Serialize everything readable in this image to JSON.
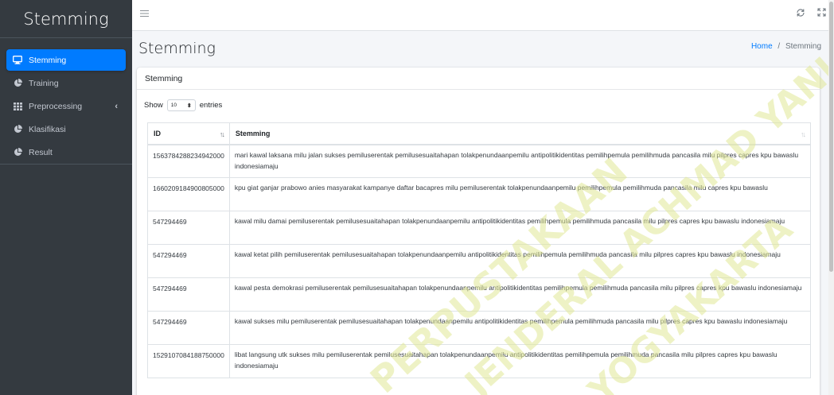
{
  "sidebar": {
    "brand": "Stemming",
    "items": [
      {
        "label": "Stemming",
        "icon": "desktop-icon",
        "active": true
      },
      {
        "label": "Training",
        "icon": "pie-chart-icon"
      },
      {
        "label": "Preprocessing",
        "icon": "table-icon"
      },
      {
        "label": "Klasifikasi",
        "icon": "pie-chart-icon"
      },
      {
        "label": "Result",
        "icon": "pie-chart-icon"
      }
    ]
  },
  "header": {
    "title": "Stemming",
    "breadcrumb_home": "Home",
    "breadcrumb_sep": "/",
    "breadcrumb_current": "Stemming"
  },
  "card": {
    "title": "Stemming",
    "show_label": "Show",
    "entries_value": "10",
    "entries_label": "entries"
  },
  "table": {
    "headers": [
      "ID",
      "Stemming"
    ],
    "rows": [
      {
        "id": "1563784288234942000",
        "text": "mari kawal laksana milu jalan sukses pemiluserentak pemilusesuaitahapan tolakpenundaanpemilu antipolitikidentitas pemilihpemula pemilihmuda pancasila milu pilpres capres kpu bawaslu indonesiamaju"
      },
      {
        "id": "1660209184900805000",
        "text": "kpu giat ganjar prabowo anies masyarakat kampanye daftar bacapres milu pemiluserentak tolakpenundaanpemilu pemilihpemula pemilihmuda pancasila milu capres kpu bawaslu"
      },
      {
        "id": "547294469",
        "text": "kawal milu damai pemiluserentak pemilusesuaitahapan tolakpenundaanpemilu antipolitikidentitas pemilihpemula pemilihmuda pancasila milu pilpres capres kpu bawaslu indonesiamaju"
      },
      {
        "id": "547294469",
        "text": "kawal ketat pilih pemiluserentak pemilusesuaitahapan tolakpenundaanpemilu antipolitikidentitas pemilihpemula pemilihmuda pancasila milu pilpres capres kpu bawaslu indonesiamaju"
      },
      {
        "id": "547294469",
        "text": "kawal pesta demokrasi pemiluserentak pemilusesuaitahapan tolakpenundaanpemilu antipolitikidentitas pemilihpemula pemilihmuda pancasila milu pilpres capres kpu bawaslu indonesiamaju"
      },
      {
        "id": "547294469",
        "text": "kawal sukses milu pemiluserentak pemilusesuaitahapan tolakpenundaanpemilu antipolitikidentitas pemilihpemula pemilihmuda pancasila milu pilpres capres kpu bawaslu indonesiamaju"
      },
      {
        "id": "1529107084188750000",
        "text": "libat langsung utk sukses milu pemiluserentak pemilusesuaitahapan tolakpenundaanpemilu antipolitikidentitas pemilihpemula pemilihmuda pancasila milu pilpres capres kpu bawaslu indonesiamaju"
      }
    ]
  },
  "watermark": {
    "line1": "PERPUSTAKAAN",
    "line2": "JENDERAL ACHMAD YANI",
    "line3": "YOGYAKARTA"
  },
  "colors": {
    "sidebar_bg": "#343a40",
    "active": "#007bff",
    "watermark": "#e0e896"
  }
}
